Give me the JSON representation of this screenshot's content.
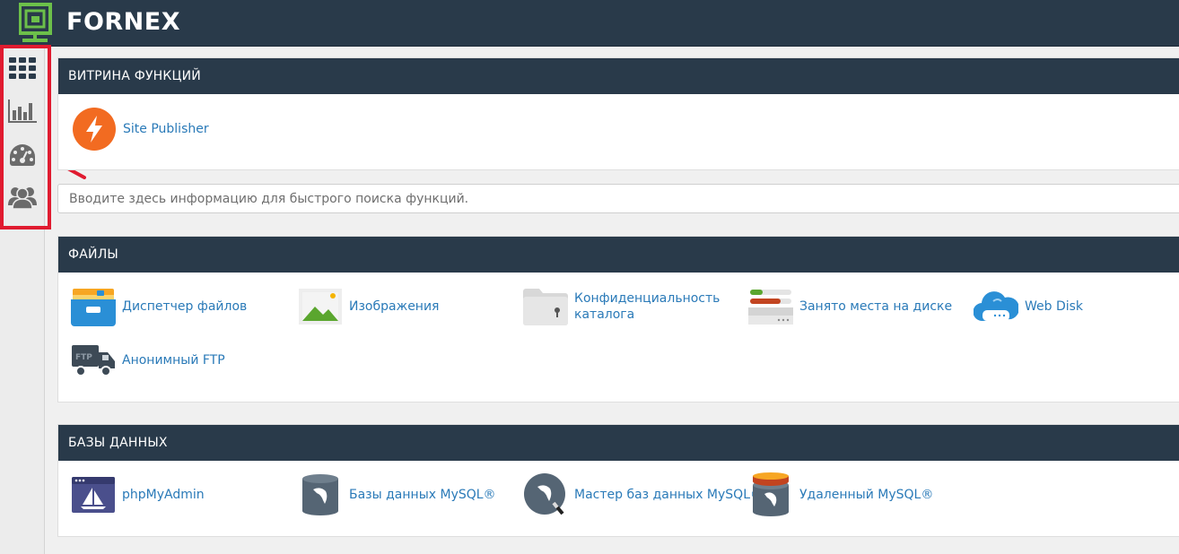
{
  "brand": {
    "name": "FORNEX",
    "logo_icon": "fornex-logo-icon"
  },
  "sidebar": {
    "items": [
      {
        "name": "tools-grid-icon",
        "label": ""
      },
      {
        "name": "stats-bar-chart-icon",
        "label": ""
      },
      {
        "name": "dashboard-gauge-icon",
        "label": ""
      },
      {
        "name": "users-group-icon",
        "label": ""
      }
    ]
  },
  "featured": {
    "title": "ВИТРИНА ФУНКЦИЙ",
    "items": [
      {
        "label": "Site Publisher",
        "icon": "lightning-icon"
      }
    ]
  },
  "search": {
    "placeholder": "Вводите здесь информацию для быстрого поиска функций."
  },
  "files": {
    "title": "ФАЙЛЫ",
    "items": [
      {
        "label": "Диспетчер файлов",
        "icon": "file-manager-icon"
      },
      {
        "label": "Изображения",
        "icon": "images-icon"
      },
      {
        "label": "Конфиденциальность каталога",
        "icon": "directory-privacy-icon"
      },
      {
        "label": "Занято места на диске",
        "icon": "disk-usage-icon"
      },
      {
        "label": "Web Disk",
        "icon": "web-disk-icon"
      },
      {
        "label": "Анонимный FTP",
        "icon": "anonymous-ftp-icon"
      }
    ]
  },
  "databases": {
    "title": "БАЗЫ ДАННЫХ",
    "items": [
      {
        "label": "phpMyAdmin",
        "icon": "phpmyadmin-icon"
      },
      {
        "label": "Базы данных MySQL®",
        "icon": "mysql-databases-icon"
      },
      {
        "label": "Мастер баз данных MySQL®",
        "icon": "mysql-wizard-icon"
      },
      {
        "label": "Удаленный MySQL®",
        "icon": "remote-mysql-icon"
      }
    ]
  },
  "colors": {
    "header_bg": "#293a4a",
    "link": "#2a7ab8",
    "highlight": "#e01b30",
    "accent_orange": "#f26b21"
  }
}
